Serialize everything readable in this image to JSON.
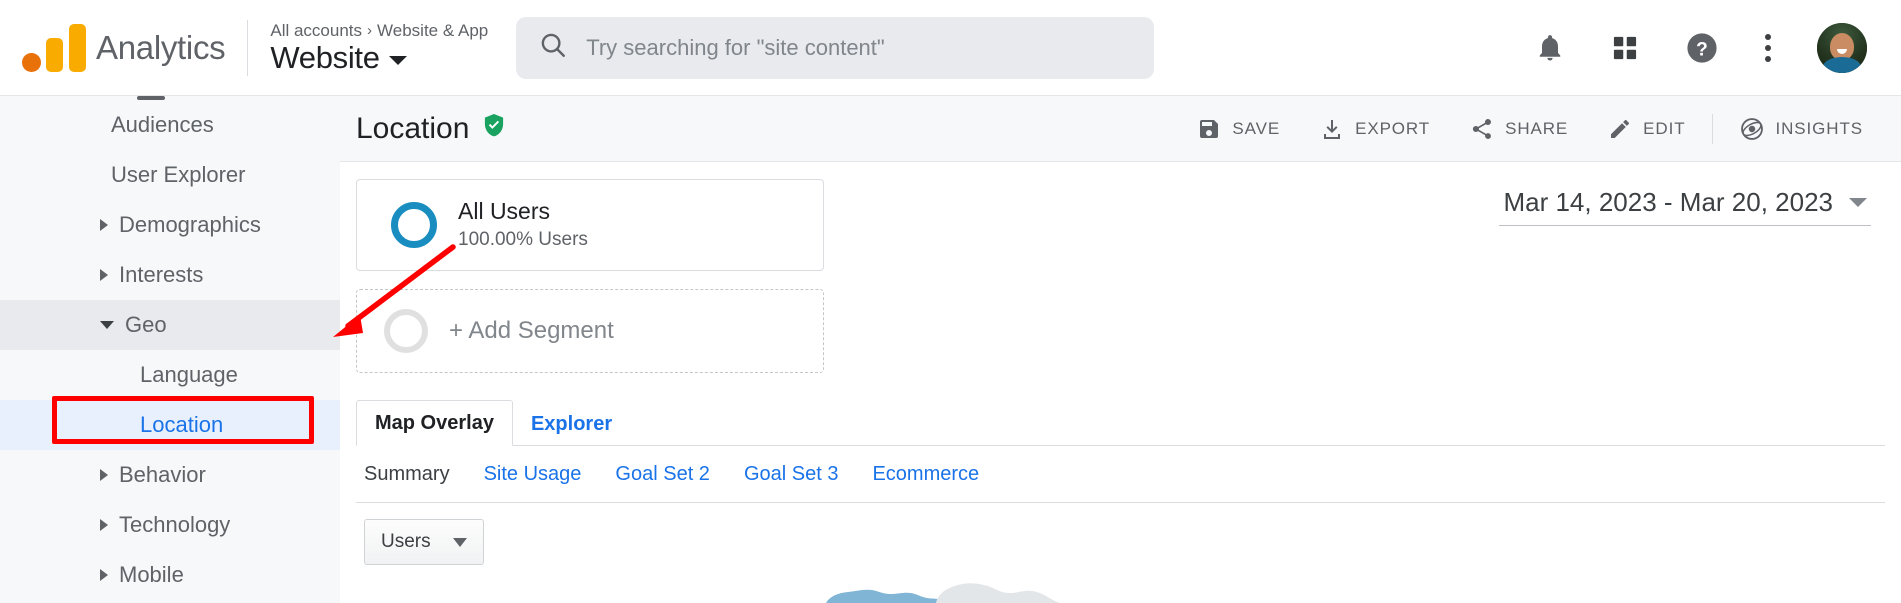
{
  "app": {
    "brand": "Analytics",
    "logo_icon": "analytics-logo-icon"
  },
  "account": {
    "breadcrumb_account": "All accounts",
    "breadcrumb_separator": "›",
    "breadcrumb_property": "Website & App",
    "selected_view": "Website",
    "dropdown_icon": "caret-down-icon"
  },
  "search": {
    "placeholder": "Try searching for \"site content\"",
    "value": "",
    "icon": "search-icon"
  },
  "header_icons": [
    {
      "name": "notifications-bell-icon",
      "label": "Notifications"
    },
    {
      "name": "apps-grid-icon",
      "label": "Google apps"
    },
    {
      "name": "help-question-icon",
      "label": "Help"
    },
    {
      "name": "more-vert-kebab-icon",
      "label": "More options"
    },
    {
      "name": "user-avatar",
      "label": "Account"
    }
  ],
  "sidebar": {
    "items": [
      {
        "label": "Audiences",
        "level": "plain",
        "expandable": false,
        "state": "normal"
      },
      {
        "label": "User Explorer",
        "level": "plain",
        "expandable": false,
        "state": "normal"
      },
      {
        "label": "Demographics",
        "level": "group",
        "expandable": true,
        "expanded": false,
        "state": "normal"
      },
      {
        "label": "Interests",
        "level": "group",
        "expandable": true,
        "expanded": false,
        "state": "normal"
      },
      {
        "label": "Geo",
        "level": "group",
        "expandable": true,
        "expanded": true,
        "state": "hovered"
      },
      {
        "label": "Language",
        "level": "child",
        "expandable": false,
        "state": "normal"
      },
      {
        "label": "Location",
        "level": "child",
        "expandable": false,
        "state": "selected"
      },
      {
        "label": "Behavior",
        "level": "group",
        "expandable": true,
        "expanded": false,
        "state": "normal"
      },
      {
        "label": "Technology",
        "level": "group",
        "expandable": true,
        "expanded": false,
        "state": "normal"
      },
      {
        "label": "Mobile",
        "level": "group",
        "expandable": true,
        "expanded": false,
        "state": "normal"
      }
    ]
  },
  "report": {
    "title": "Location",
    "verified_icon": "shield-check-icon",
    "verified_color": "#1aa260"
  },
  "toolbar": {
    "buttons": [
      {
        "label": "SAVE",
        "icon": "save-disk-icon"
      },
      {
        "label": "EXPORT",
        "icon": "download-export-icon"
      },
      {
        "label": "SHARE",
        "icon": "share-nodes-icon"
      },
      {
        "label": "EDIT",
        "icon": "pencil-edit-icon"
      },
      {
        "label": "INSIGHTS",
        "icon": "insights-atom-icon"
      }
    ]
  },
  "segments": {
    "active": {
      "name": "All Users",
      "sub": "100.00% Users",
      "ring_color": "#1a8dc0"
    },
    "add": {
      "label": "+ Add Segment",
      "ring_color": "#e0e0e0"
    }
  },
  "date_range": {
    "value": "Mar 14, 2023 - Mar 20, 2023",
    "dropdown_icon": "caret-down-icon"
  },
  "tabs": [
    {
      "label": "Map Overlay",
      "active": true
    },
    {
      "label": "Explorer",
      "active": false
    }
  ],
  "subtabs": [
    {
      "label": "Summary",
      "active": true
    },
    {
      "label": "Site Usage",
      "active": false
    },
    {
      "label": "Goal Set 2",
      "active": false
    },
    {
      "label": "Goal Set 3",
      "active": false
    },
    {
      "label": "Ecommerce",
      "active": false
    }
  ],
  "metric_selector": {
    "value": "Users",
    "dropdown_icon": "caret-down-icon"
  },
  "annotations": {
    "highlight_box": {
      "target": "Location",
      "color": "#ff0000"
    },
    "arrow": {
      "target": "Geo",
      "color": "#ff0000"
    }
  },
  "colors": {
    "accent_blue": "#1a73e8",
    "selected_bg": "#e8f0fe",
    "hover_bg": "#e8eaed",
    "sidebar_bg": "#f7f8f9",
    "text_primary": "#202124",
    "text_secondary": "#5f6368",
    "brand_orange": "#f9ab00",
    "annotation_red": "#ff0000"
  }
}
